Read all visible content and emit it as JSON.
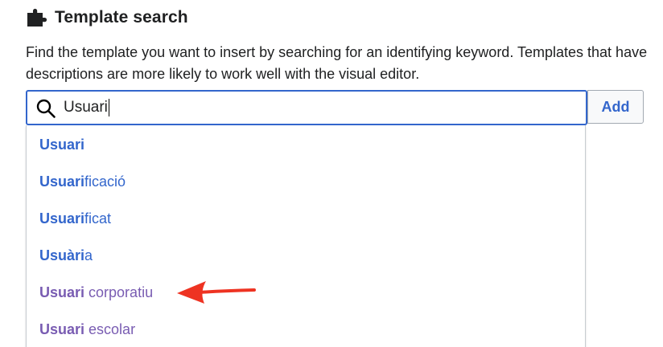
{
  "header": {
    "icon": "puzzle-piece-icon",
    "title": "Template search"
  },
  "description": "Find the template you want to insert by searching for an identifying keyword. Templates that have descriptions are more likely to work well with the visual editor.",
  "search": {
    "icon": "search-icon",
    "value": "Usuari",
    "focused": true,
    "border_color": "#3366cc"
  },
  "add_button": {
    "label": "Add"
  },
  "suggestions": [
    {
      "match": "Usuari",
      "rest": "",
      "visited": false
    },
    {
      "match": "Usuari",
      "rest": "ficació",
      "visited": false
    },
    {
      "match": "Usuari",
      "rest": "ficat",
      "visited": false
    },
    {
      "match": "Usuàri",
      "rest": "a",
      "visited": false
    },
    {
      "match": "Usuari",
      "rest": " corporatiu",
      "visited": true
    },
    {
      "match": "Usuari",
      "rest": " escolar",
      "visited": true
    }
  ],
  "annotation": {
    "icon": "red-arrow-icon",
    "color": "#ee3322",
    "points_to": "Usuari corporatiu"
  },
  "colors": {
    "link": "#3366cc",
    "visited_link": "#795cb2",
    "text": "#202122"
  }
}
